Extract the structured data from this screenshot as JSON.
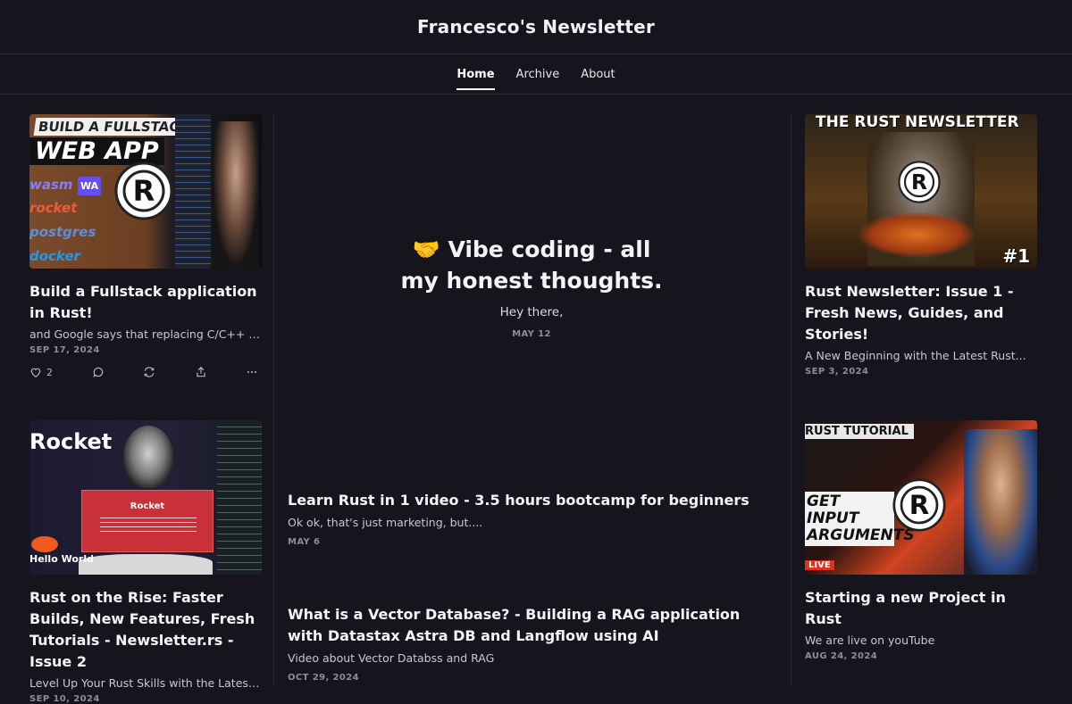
{
  "site": {
    "title": "Francesco's Newsletter"
  },
  "nav": {
    "items": [
      "Home",
      "Archive",
      "About"
    ]
  },
  "feature": {
    "emoji": "🤝",
    "title": "Vibe coding - all my honest thoughts.",
    "subtitle": "Hey there,",
    "date": "MAY 12"
  },
  "cards": [
    {
      "thumb_text": [
        "BUILD A FULLSTACK",
        "WEB APP",
        "wasm",
        "WA",
        "rocket",
        "postgres",
        "docker"
      ],
      "title": "Build a Fullstack application in Rust!",
      "subtitle": "and Google says that replacing C/C++ in...",
      "date": "SEP 17, 2024",
      "likes": "2"
    },
    {
      "thumb_text": [
        "THE RUST NEWSLETTER",
        "#1"
      ],
      "title": "Rust Newsletter: Issue 1 - Fresh News, Guides, and Stories!",
      "subtitle": "A New Beginning with the Latest Rust...",
      "date": "SEP 3, 2024"
    },
    {
      "thumb_text": [
        "Rocket",
        "Rocket",
        "Hello World"
      ],
      "title": "Rust on the Rise: Faster Builds, New Features, Fresh Tutorials - Newsletter.rs - Issue 2",
      "subtitle": "Level Up Your Rust Skills with the Latest Too...",
      "date": "SEP 10, 2024"
    },
    {
      "thumb_text": [
        "RUST TUTORIAL",
        "GET INPUT ARGUMENTS",
        "LIVE"
      ],
      "title": "Starting a new Project in Rust",
      "subtitle": "We are live on youTube",
      "date": "AUG 24, 2024"
    }
  ],
  "mid_posts": [
    {
      "title": "Learn Rust in 1 video - 3.5 hours bootcamp for beginners",
      "subtitle": "Ok ok, that's just marketing, but....",
      "date": "MAY 6"
    },
    {
      "title": "What is a Vector Database? - Building a RAG application with Datastax Astra DB and Langflow using AI",
      "subtitle": "Video about Vector Databss and RAG",
      "date": "OCT 29, 2024"
    }
  ],
  "colors": {
    "background": "#16141c",
    "divider": "#2c2a33",
    "accent": "#ffffff"
  }
}
